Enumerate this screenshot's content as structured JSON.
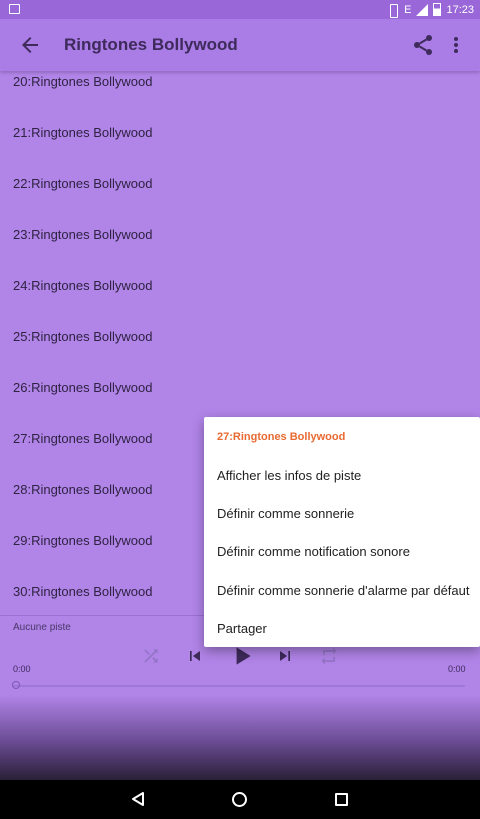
{
  "status_bar": {
    "network": "E",
    "time": "17:23"
  },
  "app_bar": {
    "title": "Ringtones Bollywood"
  },
  "list": {
    "items": [
      "20:Ringtones Bollywood",
      "21:Ringtones Bollywood",
      "22:Ringtones Bollywood",
      "23:Ringtones Bollywood",
      "24:Ringtones Bollywood",
      "25:Ringtones Bollywood",
      "26:Ringtones Bollywood",
      "27:Ringtones Bollywood",
      "28:Ringtones Bollywood",
      "29:Ringtones Bollywood",
      "30:Ringtones Bollywood"
    ]
  },
  "player": {
    "track_label": "Aucune piste",
    "time_elapsed": "0:00",
    "time_total": "0:00",
    "progress": 0
  },
  "context_menu": {
    "title": "27:Ringtones Bollywood",
    "items": [
      "Afficher les infos de piste",
      "Définir comme sonnerie",
      "Définir comme notification sonore",
      "Définir comme sonnerie d'alarme par défaut",
      "Partager"
    ]
  },
  "colors": {
    "accent": "#e86a32",
    "background": "#b184e8",
    "app_bar": "#a97ce6"
  },
  "icons": [
    "back-arrow-icon",
    "share-icon",
    "more-vert-icon",
    "shuffle-icon",
    "skip-previous-icon",
    "play-icon",
    "skip-next-icon",
    "repeat-icon"
  ]
}
